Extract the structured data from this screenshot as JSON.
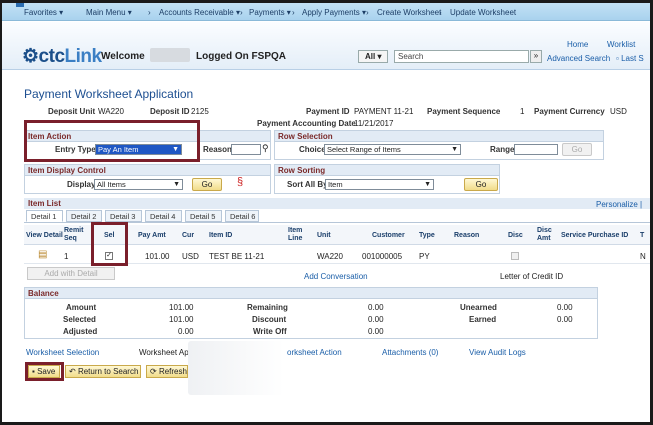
{
  "nav": {
    "favorites": "Favorites",
    "main_menu": "Main Menu",
    "accounts_receivable": "Accounts Receivable",
    "payments": "Payments",
    "apply_payments": "Apply Payments",
    "create_worksheet": "Create Worksheet",
    "update_worksheet": "Update Worksheet"
  },
  "header": {
    "logo_prefix": "ctc",
    "logo_suffix": "Link",
    "welcome": "Welcome",
    "logged_on": "Logged On FSPQA",
    "home": "Home",
    "worklist": "Worklist",
    "search_scope": "All",
    "search_placeholder": "Search",
    "advanced_search": "Advanced Search",
    "last_search": "Last S"
  },
  "page": {
    "title": "Payment Worksheet Application",
    "deposit_unit_label": "Deposit Unit",
    "deposit_unit": "WA220",
    "deposit_id_label": "Deposit ID",
    "deposit_id": "2125",
    "payment_id_label": "Payment ID",
    "payment_id": "PAYMENT 11-21",
    "payment_sequence_label": "Payment Sequence",
    "payment_sequence": "1",
    "payment_currency_label": "Payment Currency",
    "payment_currency": "USD",
    "accounting_date_label": "Payment Accounting Date",
    "accounting_date": "11/21/2017"
  },
  "item_action": {
    "header": "Item Action",
    "entry_type_label": "Entry Type",
    "entry_type_value": "Pay An Item",
    "reason_label": "Reason"
  },
  "row_selection": {
    "header": "Row Selection",
    "choice_label": "Choice",
    "choice_value": "Select Range of Items",
    "range_label": "Range",
    "go": "Go"
  },
  "item_display": {
    "header": "Item Display Control",
    "display_label": "Display",
    "display_value": "All Items",
    "go": "Go"
  },
  "row_sorting": {
    "header": "Row Sorting",
    "sort_label": "Sort All By",
    "sort_value": "Item",
    "go": "Go"
  },
  "item_list": {
    "header": "Item List",
    "personalize": "Personalize",
    "tabs": [
      "Detail 1",
      "Detail 2",
      "Detail 3",
      "Detail 4",
      "Detail 5",
      "Detail 6"
    ],
    "columns": {
      "view_detail": "View Detail",
      "remit_seq": "Remit Seq",
      "sel": "Sel",
      "pay_amt": "Pay Amt",
      "cur": "Cur",
      "item_id": "Item ID",
      "item_line": "Item Line",
      "unit": "Unit",
      "customer": "Customer",
      "type": "Type",
      "reason": "Reason",
      "disc": "Disc",
      "disc_amt": "Disc Amt",
      "service_purchase_id": "Service Purchase ID",
      "trailing": "T"
    },
    "row": {
      "remit_seq": "1",
      "sel_mark": "✓",
      "pay_amt": "101.00",
      "cur": "USD",
      "item_id": "TEST BE 11-21",
      "unit": "WA220",
      "customer": "001000005",
      "type": "PY",
      "trailing": "N"
    },
    "add_with_detail": "Add with Detail",
    "add_conversation": "Add Conversation",
    "letter_of_credit": "Letter of Credit ID"
  },
  "balance": {
    "header": "Balance",
    "amount_label": "Amount",
    "amount": "101.00",
    "selected_label": "Selected",
    "selected": "101.00",
    "adjusted_label": "Adjusted",
    "adjusted": "0.00",
    "remaining_label": "Remaining",
    "remaining": "0.00",
    "discount_label": "Discount",
    "discount": "0.00",
    "writeoff_label": "Write Off",
    "writeoff": "0.00",
    "unearned_label": "Unearned",
    "unearned": "0.00",
    "earned_label": "Earned",
    "earned": "0.00"
  },
  "footer_links": {
    "worksheet_selection": "Worksheet Selection",
    "worksheet_app": "Worksheet Ap",
    "worksheet_action": "orksheet Action",
    "attachments": "Attachments (0)",
    "view_audit_logs": "View Audit Logs"
  },
  "buttons": {
    "save": "Save",
    "return_to_search": "Return to Search",
    "refresh": "Refresh"
  },
  "colors": {
    "highlight": "#7a1f2b",
    "link": "#1a5ea8",
    "section_header": "#e2ebf5",
    "button": "#f1dc8a"
  }
}
